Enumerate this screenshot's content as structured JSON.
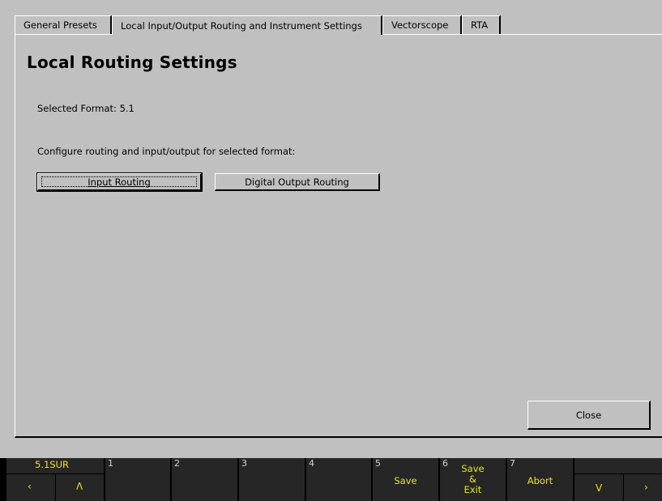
{
  "tabs": [
    {
      "label": "General Presets"
    },
    {
      "label": "Local Input/Output Routing and Instrument Settings"
    },
    {
      "label": "Vectorscope"
    },
    {
      "label": "RTA"
    }
  ],
  "main": {
    "title": "Local Routing Settings",
    "selected_format": "Selected Format: 5.1",
    "configure_text": "Configure routing and input/output for selected format:",
    "input_routing_label": "Input Routing",
    "digital_output_routing_label": "Digital Output Routing",
    "close_label": "Close"
  },
  "function_bar": {
    "mode_label": "5.1SUR",
    "left_arrow": "‹",
    "up_arrow": "Λ",
    "down_arrow": "V",
    "right_arrow": "›",
    "keys": [
      {
        "num": "1",
        "label": ""
      },
      {
        "num": "2",
        "label": ""
      },
      {
        "num": "3",
        "label": ""
      },
      {
        "num": "4",
        "label": ""
      },
      {
        "num": "5",
        "label": "Save"
      },
      {
        "num": "6",
        "label_line1": "Save",
        "label_line2": "&",
        "label_line3": "Exit"
      },
      {
        "num": "7",
        "label": "Abort"
      }
    ]
  },
  "colors": {
    "background": "#c0c0c0",
    "function_bar_bg": "#262626",
    "function_label": "#e8e800"
  }
}
